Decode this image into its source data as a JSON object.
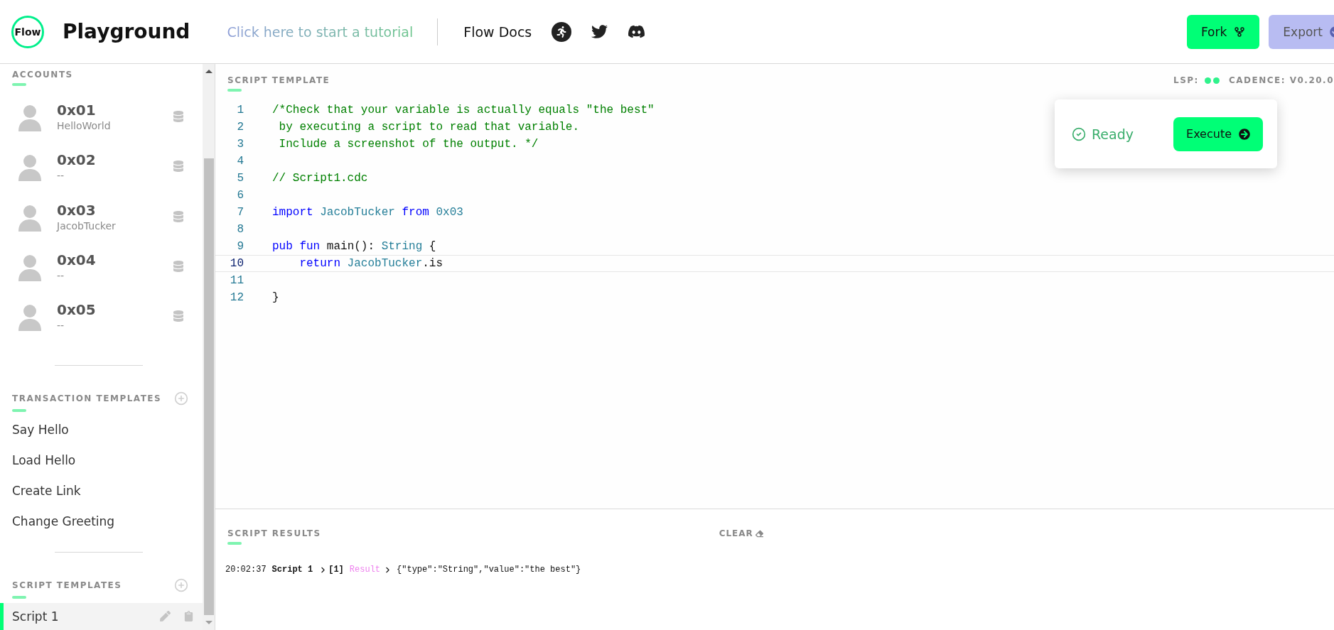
{
  "header": {
    "logo": "Flow",
    "title": "Playground",
    "tutorial_link": "Click here to start a tutorial",
    "docs_link": "Flow Docs",
    "buttons": [
      {
        "label": "Fork",
        "kind": "fork"
      },
      {
        "label": "Export",
        "kind": "export"
      }
    ]
  },
  "sidebar": {
    "accounts_heading": "ACCOUNTS",
    "accounts": [
      {
        "address": "0x01",
        "name": "HelloWorld"
      },
      {
        "address": "0x02",
        "name": "--"
      },
      {
        "address": "0x03",
        "name": "JacobTucker"
      },
      {
        "address": "0x04",
        "name": "--"
      },
      {
        "address": "0x05",
        "name": "--"
      }
    ],
    "transaction_heading": "TRANSACTION TEMPLATES",
    "transactions": [
      {
        "label": "Say Hello"
      },
      {
        "label": "Load Hello"
      },
      {
        "label": "Create Link"
      },
      {
        "label": "Change Greeting"
      }
    ],
    "script_heading": "SCRIPT TEMPLATES",
    "scripts": [
      {
        "label": "Script 1",
        "selected": true
      }
    ]
  },
  "editor": {
    "heading": "SCRIPT TEMPLATE",
    "lsp_label": "LSP:",
    "cadence_version": "CADENCE: V0.20.0",
    "lines": [
      {
        "number": "1",
        "current": false,
        "tokens": [
          {
            "text": "/*Check that your variable is actually equals \"the best\"",
            "kind": "comment"
          }
        ]
      },
      {
        "number": "2",
        "current": false,
        "tokens": [
          {
            "text": " by executing a script to read that variable.",
            "kind": "comment"
          }
        ]
      },
      {
        "number": "3",
        "current": false,
        "tokens": [
          {
            "text": " Include a screenshot of the output. */",
            "kind": "comment"
          }
        ]
      },
      {
        "number": "4",
        "current": false
      },
      {
        "number": "5",
        "current": false,
        "tokens": [
          {
            "text": "// Script1.cdc",
            "kind": "comment"
          }
        ]
      },
      {
        "number": "6",
        "current": false
      },
      {
        "number": "7",
        "current": false,
        "tokens": [
          {
            "text": "import",
            "kind": "keyword"
          },
          {
            "text": " JacobTucker",
            "kind": "type"
          },
          {
            "text": " from",
            "kind": "keyword"
          },
          {
            "text": " 0x03",
            "kind": "type"
          }
        ]
      },
      {
        "number": "8",
        "current": false
      },
      {
        "number": "9",
        "current": false,
        "tokens": [
          {
            "text": "pub fun",
            "kind": "keyword"
          },
          {
            "text": " main(): ",
            "kind": "plain"
          },
          {
            "text": "String",
            "kind": "type"
          },
          {
            "text": " {",
            "kind": "plain"
          }
        ]
      },
      {
        "number": "10",
        "current": true,
        "tokens": [
          {
            "text": "    return",
            "kind": "keyword"
          },
          {
            "text": " JacobTucker",
            "kind": "type"
          },
          {
            "text": ".is",
            "kind": "plain"
          }
        ]
      },
      {
        "number": "11",
        "current": false
      },
      {
        "number": "12",
        "current": false,
        "tokens": [
          {
            "text": "}",
            "kind": "plain"
          }
        ]
      }
    ],
    "status": "Ready",
    "execute_button": "Execute"
  },
  "results": {
    "heading": "SCRIPT RESULTS",
    "clear_button": "CLEAR",
    "entries": [
      {
        "time": "20:02:37",
        "script": "Script 1",
        "index": "[1]",
        "label": "Result",
        "value": "{\"type\":\"String\",\"value\":\"the best\"}"
      }
    ]
  }
}
